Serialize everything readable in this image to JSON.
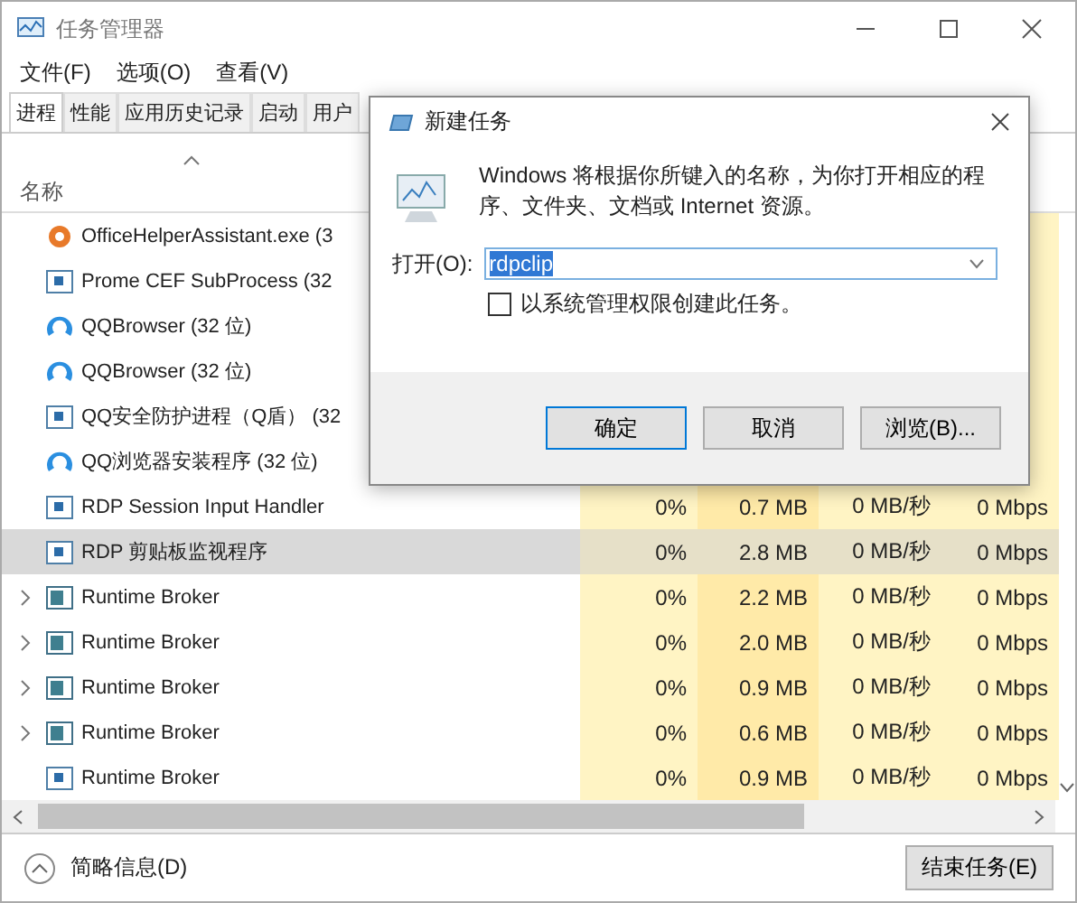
{
  "window": {
    "title": "任务管理器"
  },
  "menu": [
    "文件(F)",
    "选项(O)",
    "查看(V)"
  ],
  "tabs": [
    {
      "label": "进程",
      "selected": true
    },
    {
      "label": "性能",
      "selected": false
    },
    {
      "label": "应用历史记录",
      "selected": false
    },
    {
      "label": "启动",
      "selected": false
    },
    {
      "label": "用户",
      "selected": false
    }
  ],
  "columns": {
    "name": "名称"
  },
  "rows": [
    {
      "kind": "office",
      "name": "OfficeHelperAssistant.exe (3",
      "expandable": false,
      "selected": false
    },
    {
      "kind": "app",
      "name": "Prome CEF SubProcess (32",
      "expandable": false,
      "selected": false
    },
    {
      "kind": "qq",
      "name": "QQBrowser (32 位)",
      "expandable": false,
      "selected": false
    },
    {
      "kind": "qq",
      "name": "QQBrowser (32 位)",
      "expandable": false,
      "selected": false
    },
    {
      "kind": "app",
      "name": "QQ安全防护进程（Q盾） (32",
      "expandable": false,
      "selected": false
    },
    {
      "kind": "qq",
      "name": "QQ浏览器安装程序 (32 位)",
      "expandable": false,
      "selected": false
    },
    {
      "kind": "app",
      "name": "RDP Session Input Handler",
      "expandable": false,
      "selected": false,
      "cpu": "0%",
      "memory": "0.7 MB",
      "disk": "0 MB/秒",
      "network": "0 Mbps"
    },
    {
      "kind": "app",
      "name": "RDP 剪贴板监视程序",
      "expandable": false,
      "selected": true,
      "cpu": "0%",
      "memory": "2.8 MB",
      "disk": "0 MB/秒",
      "network": "0 Mbps"
    },
    {
      "kind": "broker",
      "name": "Runtime Broker",
      "expandable": true,
      "selected": false,
      "cpu": "0%",
      "memory": "2.2 MB",
      "disk": "0 MB/秒",
      "network": "0 Mbps"
    },
    {
      "kind": "broker",
      "name": "Runtime Broker",
      "expandable": true,
      "selected": false,
      "cpu": "0%",
      "memory": "2.0 MB",
      "disk": "0 MB/秒",
      "network": "0 Mbps"
    },
    {
      "kind": "broker",
      "name": "Runtime Broker",
      "expandable": true,
      "selected": false,
      "cpu": "0%",
      "memory": "0.9 MB",
      "disk": "0 MB/秒",
      "network": "0 Mbps"
    },
    {
      "kind": "broker",
      "name": "Runtime Broker",
      "expandable": true,
      "selected": false,
      "cpu": "0%",
      "memory": "0.6 MB",
      "disk": "0 MB/秒",
      "network": "0 Mbps"
    },
    {
      "kind": "app",
      "name": "Runtime Broker",
      "expandable": false,
      "selected": false,
      "cpu": "0%",
      "memory": "0.9 MB",
      "disk": "0 MB/秒",
      "network": "0 Mbps"
    }
  ],
  "footer": {
    "details_toggle": "简略信息(D)",
    "end_task_button": "结束任务(E)"
  },
  "dialog": {
    "title": "新建任务",
    "message": "Windows 将根据你所键入的名称，为你打开相应的程序、文件夹、文档或 Internet 资源。",
    "open_label": "打开(O):",
    "value": "rdpclip",
    "value_selected": true,
    "admin_checkbox": {
      "label": "以系统管理权限创建此任务。",
      "checked": false
    },
    "buttons": [
      {
        "label": "确定",
        "default": true
      },
      {
        "label": "取消",
        "default": false
      },
      {
        "label": "浏览(B)...",
        "default": false
      }
    ]
  }
}
